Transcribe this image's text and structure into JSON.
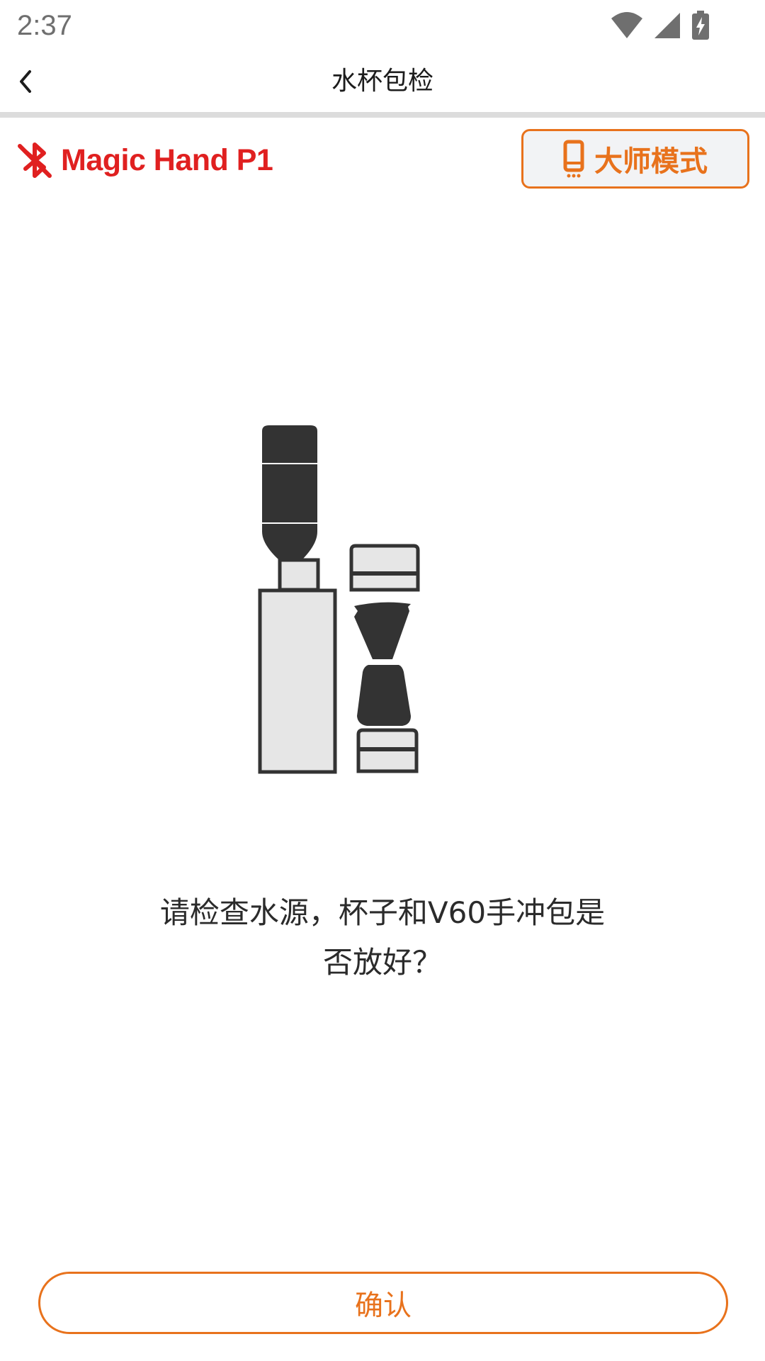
{
  "status_bar": {
    "time": "2:37",
    "icons": [
      "wifi-icon",
      "cellular-signal-icon",
      "battery-charging-icon"
    ]
  },
  "toolbar": {
    "back_icon": "chevron-left-icon",
    "title": "水杯包检"
  },
  "device": {
    "icon": "bluetooth-disconnected-icon",
    "name": "Magic Hand P1",
    "master_mode_icon": "phone-icon",
    "master_mode_label": "大师模式"
  },
  "illustration": {
    "icon": "coffee-machine-water-cup-v60-icon"
  },
  "prompt": {
    "line1": "请检查水源，杯子和V60手冲包是",
    "line2": "否放好？"
  },
  "confirm": {
    "label": "确认"
  },
  "colors": {
    "accent": "#e8721c",
    "device_red": "#e02020",
    "illustration_dark": "#333333",
    "illustration_light": "#e6e6e6"
  }
}
